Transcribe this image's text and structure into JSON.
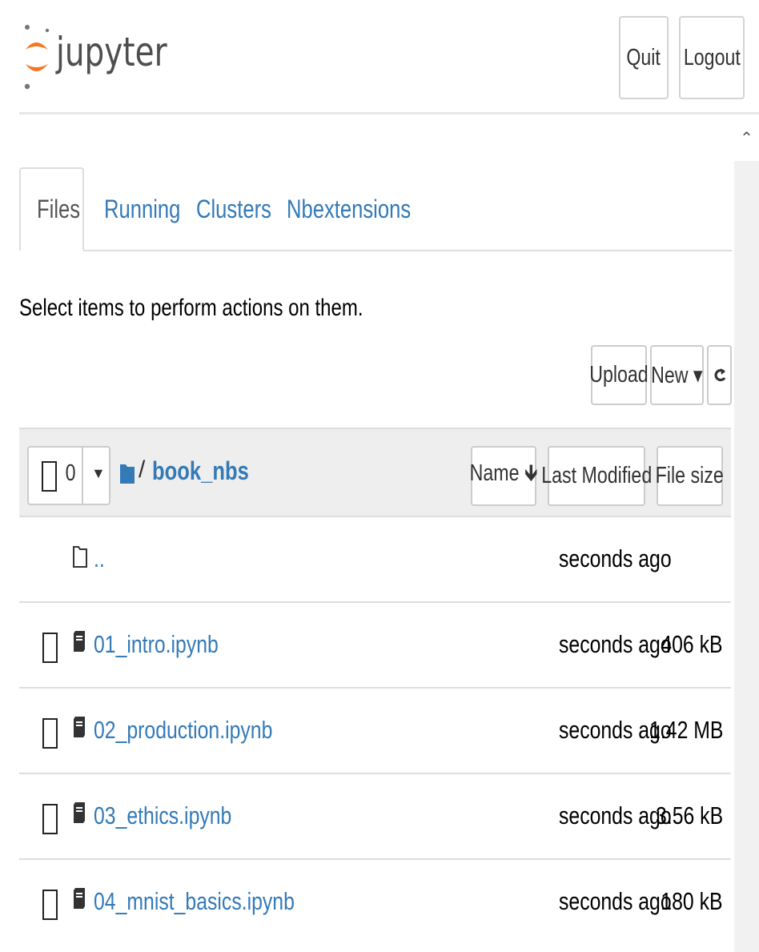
{
  "app": {
    "logo_text": "jupyter",
    "brand_color": "#f37726"
  },
  "header": {
    "quit_label": "Quit",
    "logout_label": "Logout"
  },
  "tabs": [
    {
      "label": "Files",
      "active": true
    },
    {
      "label": "Running",
      "active": false
    },
    {
      "label": "Clusters",
      "active": false
    },
    {
      "label": "Nbextensions",
      "active": false
    }
  ],
  "instructions": "Select items to perform actions on them.",
  "toolbar": {
    "upload_label": "Upload",
    "new_label": "New ▾",
    "refresh_icon": "refresh-icon"
  },
  "list_header": {
    "selected_count": "0",
    "breadcrumb_sep": "/",
    "current_dir": "book_nbs",
    "sort_name_label": "Name 🡻",
    "sort_modified_label": "Last Modified",
    "sort_size_label": "File size"
  },
  "files": [
    {
      "name": "..",
      "modified": "seconds ago",
      "size": "",
      "type": "folder",
      "checkbox": false
    },
    {
      "name": "01_intro.ipynb",
      "modified": "seconds ago",
      "size": "406 kB",
      "type": "notebook",
      "checkbox": true
    },
    {
      "name": "02_production.ipynb",
      "modified": "seconds ago",
      "size": "1.42 MB",
      "type": "notebook",
      "checkbox": true
    },
    {
      "name": "03_ethics.ipynb",
      "modified": "seconds ago",
      "size": "3.56 kB",
      "type": "notebook",
      "checkbox": true
    },
    {
      "name": "04_mnist_basics.ipynb",
      "modified": "seconds ago",
      "size": "180 kB",
      "type": "notebook",
      "checkbox": true
    }
  ],
  "colors": {
    "link": "#337ab7",
    "header_bg": "#eeeeee",
    "border": "#dddddd"
  }
}
